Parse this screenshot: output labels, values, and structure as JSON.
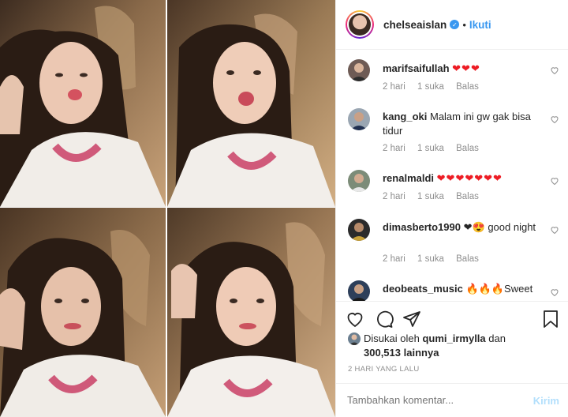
{
  "post": {
    "username": "chelseaislan",
    "follow_label": "Ikuti",
    "separator": "•",
    "verified_mark": "✓"
  },
  "photos": [
    "kiss-face",
    "tongue-out",
    "neutral-hand-in-hair",
    "neutral-smile"
  ],
  "comments": [
    {
      "user": "marifsaifullah",
      "text": "❤❤❤",
      "time": "2 hari",
      "likes": "1 suka",
      "reply": "Balas"
    },
    {
      "user": "kang_oki",
      "text": "Malam ini gw gak bisa tidur",
      "time": "2 hari",
      "likes": "1 suka",
      "reply": "Balas"
    },
    {
      "user": "renalmaldi",
      "text": "❤❤❤❤❤❤❤",
      "time": "2 hari",
      "likes": "1 suka",
      "reply": "Balas"
    },
    {
      "user": "dimasberto1990",
      "text": "❤😍 good night",
      "time": "2 hari",
      "likes": "1 suka",
      "reply": "Balas"
    },
    {
      "user": "deobeats_music",
      "text": "🔥🔥🔥Sweet",
      "time": "",
      "likes": "",
      "reply": ""
    }
  ],
  "liked_by": {
    "prefix": "Disukai oleh",
    "user": "qumi_irmylla",
    "conj": "dan",
    "count": "300,513",
    "suffix": "lainnya"
  },
  "date_label": "2 HARI YANG LALU",
  "comment_box": {
    "placeholder": "Tambahkan komentar...",
    "send_label": "Kirim"
  },
  "colors": {
    "accent": "#3897f0",
    "heart": "#ed1c24",
    "muted": "#8e8e8e"
  },
  "icons": [
    "heart-icon",
    "comment-icon",
    "share-icon",
    "bookmark-icon",
    "verified-badge-icon"
  ]
}
